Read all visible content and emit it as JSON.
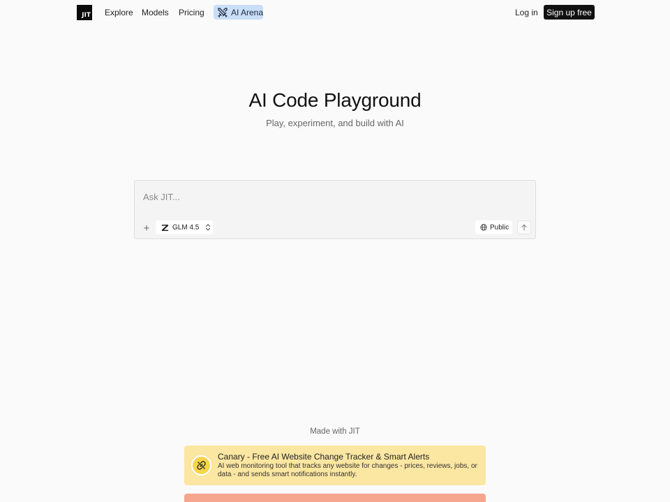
{
  "nav": {
    "logo_text": "JIT",
    "links": [
      "Explore",
      "Models",
      "Pricing"
    ],
    "arena_label": "AI Arena",
    "login_label": "Log in",
    "signup_label": "Sign up free"
  },
  "hero": {
    "title": "AI Code Playground",
    "subtitle": "Play, experiment, and build with AI"
  },
  "prompt": {
    "placeholder": "Ask JIT...",
    "value": "",
    "model_label": "GLM 4.5",
    "visibility_label": "Public"
  },
  "footer": {
    "made_with": "Made with JIT",
    "cards": [
      {
        "title": "Canary - Free AI Website Change Tracker & Smart Alerts",
        "description": "AI web monitoring tool that tracks any website for changes - prices, reviews, jobs, or data - and sends smart notifications instantly."
      }
    ]
  },
  "colors": {
    "background": "#fafafa",
    "arena_bg": "#c9def7",
    "card_yellow": "#fbe6a2",
    "card_salmon": "#f6a58f",
    "primary": "#111111"
  }
}
